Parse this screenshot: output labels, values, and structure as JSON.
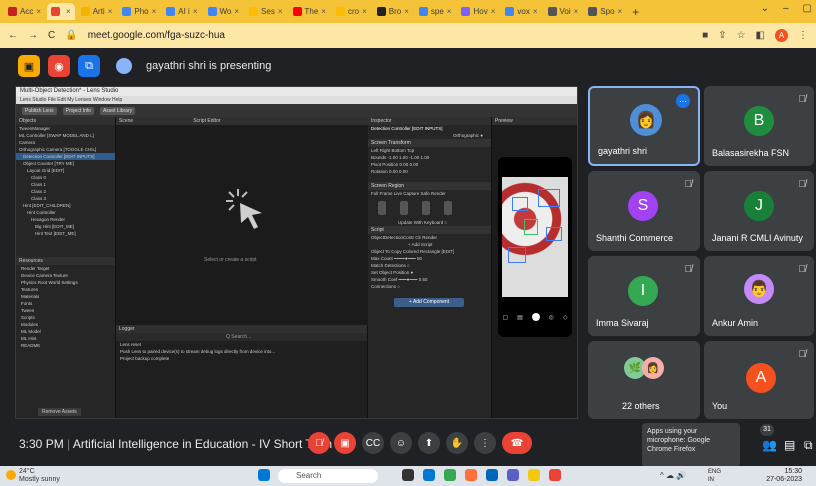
{
  "browser": {
    "tabs": [
      {
        "label": "Acc",
        "color": "#c5221f"
      },
      {
        "label": "",
        "color": "#ea4335",
        "active": true
      },
      {
        "label": "Arti",
        "color": "#f4b400"
      },
      {
        "label": "Pho",
        "color": "#4285f4"
      },
      {
        "label": "AI i",
        "color": "#4285f4"
      },
      {
        "label": "Wo",
        "color": "#4285f4"
      },
      {
        "label": "Ses",
        "color": "#fbbc04"
      },
      {
        "label": "The",
        "color": "#ff0000"
      },
      {
        "label": "cro",
        "color": "#fbbc04"
      },
      {
        "label": "Bro",
        "color": "#222222"
      },
      {
        "label": "spe",
        "color": "#4285f4"
      },
      {
        "label": "Hov",
        "color": "#7b61ff"
      },
      {
        "label": "vox",
        "color": "#4285f4"
      },
      {
        "label": "Voi",
        "color": "#555555"
      },
      {
        "label": "Spo",
        "color": "#555555"
      }
    ],
    "new_tab": "+",
    "url": "meet.google.com/fga-suzc-hua"
  },
  "meet": {
    "presenter_text": "gayathri shri is presenting",
    "meeting_time": "3:30 PM",
    "meeting_title": "Artificial Intelligence in Education - IV Short Term ...",
    "participant_count": "31",
    "tooltip": "Apps using your microphone: Google Chrome Firefox"
  },
  "participants": [
    {
      "name": "gayathri shri",
      "initial": "",
      "color": "#4f8fd6"
    },
    {
      "name": "Balasasirekha FSN",
      "initial": "B",
      "color": "#1e8e3e"
    },
    {
      "name": "Shanthi Commerce",
      "initial": "S",
      "color": "#a142f4"
    },
    {
      "name": "Janani R CMLI Avinuty",
      "initial": "J",
      "color": "#188038"
    },
    {
      "name": "Imma Sivaraj",
      "initial": "I",
      "color": "#34a853"
    },
    {
      "name": "Ankur Amin",
      "initial": "",
      "color": "#c58af9"
    },
    {
      "name": "22 others",
      "initial": "",
      "color": "#5f6368"
    },
    {
      "name": "You",
      "initial": "A",
      "color": "#f4511e"
    }
  ],
  "lens": {
    "window_title": "Multi-Object Detection* - Lens Studio",
    "menu": "Lens Studio   File   Edit   My Lenses   Window   Help",
    "toolbar": [
      "Publish Lens",
      "Project Info",
      "Asset Library"
    ],
    "objects_header": "Objects",
    "objects": [
      "TweenManager",
      "ML Controller [SWAP MODEL AND L]",
      "Camera",
      "Orthographic Camera [TOGGLE CHIL]",
      "Detection Controller [EDIT INPUTS]",
      "Object Counter [TRY ME]",
      "Layout Grid [EDIT]",
      "Class 0",
      "Class 1",
      "Class 2",
      "Class 3",
      "Hint [EDIT_CHILDREN]",
      "Hint Controller",
      "Hexagon Render",
      "Big Hint [EDIT_ME]",
      "Hint Text [EDIT_ME]"
    ],
    "resources_header": "Resources",
    "resources": [
      "Render Target",
      "Device Camera Texture",
      "Physics Root World Settings",
      "Textures",
      "Materials",
      "Fonts",
      "Tween",
      "Scripts",
      "Modules",
      "ML Model",
      "ML Hint",
      "README"
    ],
    "scene_header": "Scene",
    "script_editor_header": "Script Editor",
    "placeholder": "Select or create a script",
    "logger_header": "Logger",
    "logs": [
      "Lens reset",
      "Push Lens to paired device(s) to stream debug logs directly from device into...",
      "Project backup complete"
    ],
    "inspector_header": "Inspector",
    "inspector_title": "Detection Controller [EDIT INPUTS]",
    "inspector_sections": [
      "Screen Transform",
      "Screen Region",
      "Script"
    ],
    "preview_header": "Preview",
    "add_component": "+ Add Component",
    "remove_assets": "Remove Assets"
  },
  "taskbar": {
    "weather_temp": "24°C",
    "weather_text": "Mostly sunny",
    "search": "Search",
    "lang": "ENG IN",
    "time": "15:30",
    "date": "27-06-2023"
  }
}
